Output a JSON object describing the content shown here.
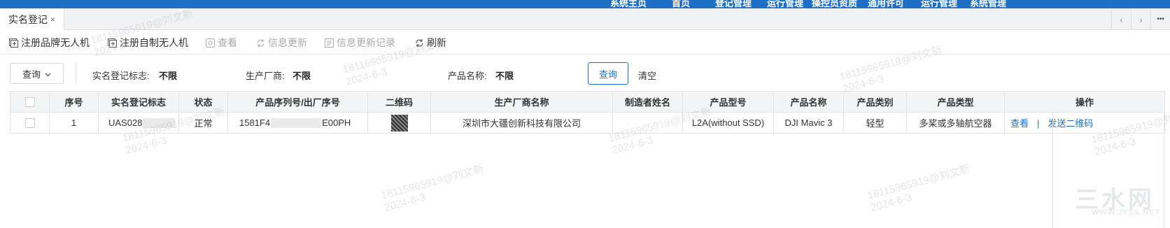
{
  "topnav": {
    "items": [
      "系统主页",
      "首页",
      "登记管理",
      "运行管理",
      "操控员资质",
      "通用许可",
      "运行管理",
      "系统管理"
    ]
  },
  "tabs": [
    {
      "label": "实名登记",
      "close": "×"
    }
  ],
  "tab_controls": {
    "prev": "‹",
    "next": "›",
    "more": "•••"
  },
  "toolbar": {
    "register_brand": "注册品牌无人机",
    "register_custom": "注册自制无人机",
    "view": "查看",
    "info_update": "信息更新",
    "info_update_log": "信息更新记录",
    "refresh": "刷新"
  },
  "filter": {
    "query_dropdown": "查询",
    "reg_flag_label": "实名登记标志:",
    "reg_flag_value": "不限",
    "manufacturer_label": "生产厂商:",
    "manufacturer_value": "不限",
    "product_name_label": "产品名称:",
    "product_name_value": "不限",
    "search_button": "查询",
    "clear_button": "清空"
  },
  "table": {
    "headers": [
      "序号",
      "实名登记标志",
      "状态",
      "产品序列号/出厂序号",
      "二维码",
      "生产厂商名称",
      "制造者姓名",
      "产品型号",
      "产品名称",
      "产品类别",
      "产品类型",
      "操作"
    ],
    "rows": [
      {
        "index": "1",
        "reg_flag": "UAS028",
        "status": "正常",
        "serial_prefix": "1581F4",
        "serial_suffix": "E00PH",
        "manufacturer": "深圳市大疆创新科技有限公司",
        "maker_name": "",
        "model": "L2A(without SSD)",
        "product_name": "DJI Mavic 3",
        "category": "轻型",
        "product_type": "多桨或多轴航空器",
        "op_view": "查看",
        "op_sep": "|",
        "op_send_qr": "发送二维码"
      }
    ]
  },
  "watermark": {
    "line1": "18115965919@刘文新",
    "line2": "2024-6-3"
  },
  "brand_watermark": {
    "main": "三水网",
    "sub": "WWW.JYSS.NET"
  },
  "colors": {
    "primary": "#1f6fc5",
    "header_bg": "#f3f4f6"
  }
}
